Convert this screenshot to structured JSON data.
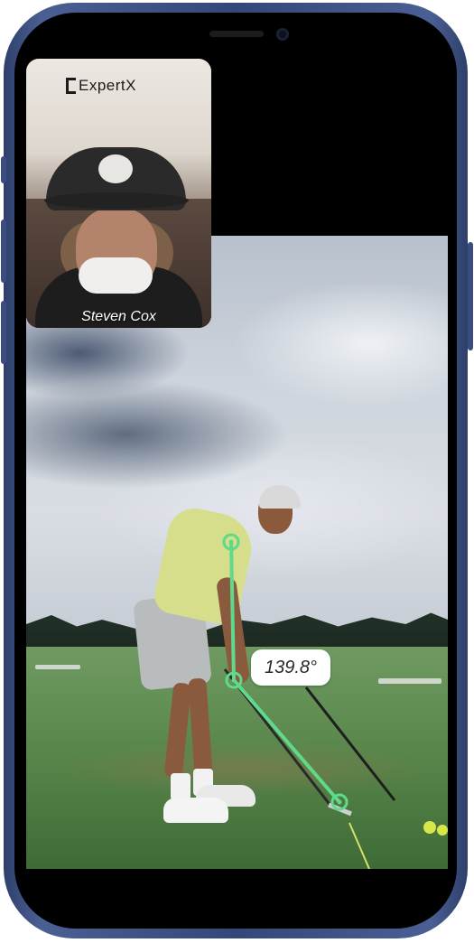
{
  "app": {
    "brand_logo": "ExpertX"
  },
  "pip": {
    "caller_name": "Steven Cox"
  },
  "analysis": {
    "angle_label": "139.8°",
    "line_color": "#5fd98c"
  },
  "device": {
    "frame_color": "#3b4d7f"
  }
}
